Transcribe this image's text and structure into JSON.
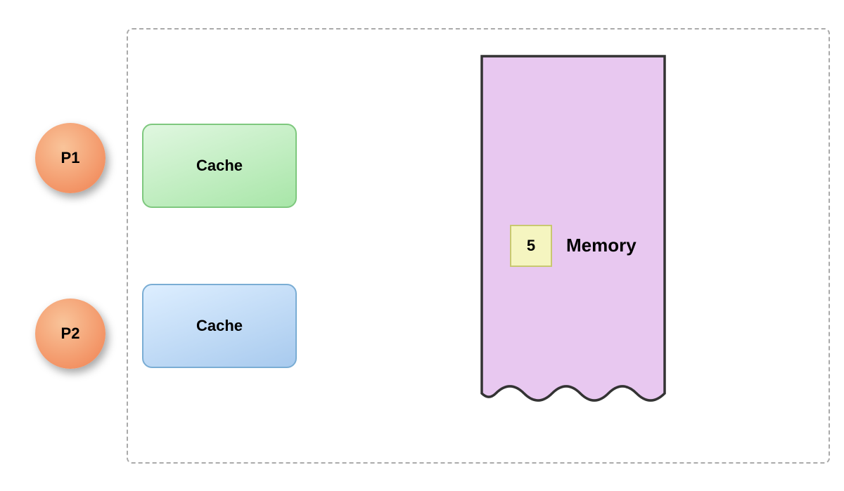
{
  "processors": [
    {
      "id": "p1",
      "label": "P1"
    },
    {
      "id": "p2",
      "label": "P2"
    }
  ],
  "caches": [
    {
      "id": "cache1",
      "label": "Cache",
      "color": "green"
    },
    {
      "id": "cache2",
      "label": "Cache",
      "color": "blue"
    }
  ],
  "memory": {
    "label": "Memory",
    "cell_value": "5"
  },
  "colors": {
    "processor_gradient_start": "#f9c49a",
    "processor_gradient_end": "#f08050",
    "cache_green_start": "#e0f7e0",
    "cache_green_end": "#a8e6a8",
    "cache_blue_start": "#ddeeff",
    "cache_blue_end": "#a8caee",
    "memory_fill": "#e8c8f0",
    "memory_stroke": "#333",
    "cell_fill": "#f5f5c0"
  }
}
